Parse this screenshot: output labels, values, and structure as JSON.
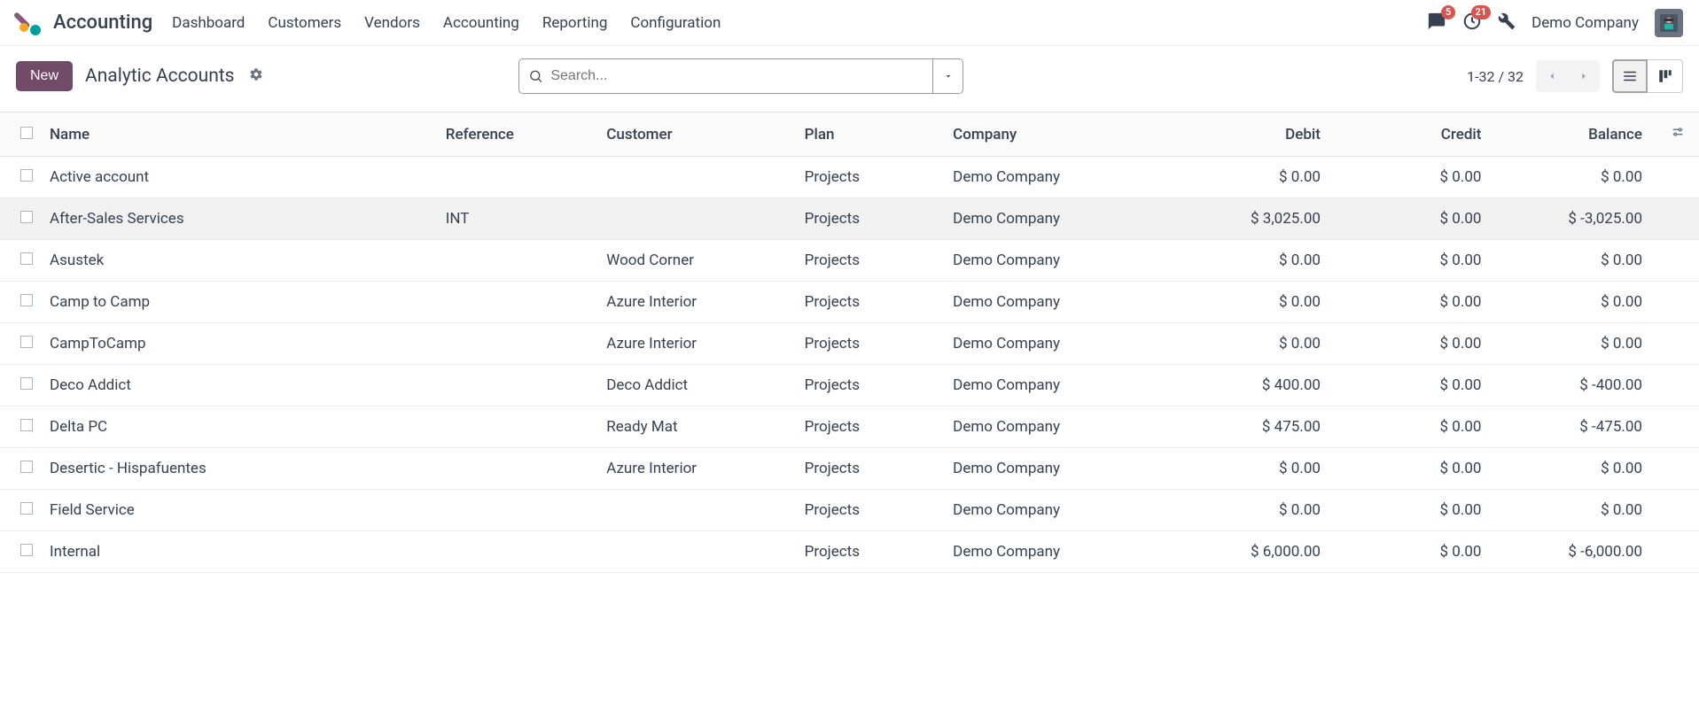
{
  "nav": {
    "app_title": "Accounting",
    "items": [
      "Dashboard",
      "Customers",
      "Vendors",
      "Accounting",
      "Reporting",
      "Configuration"
    ],
    "messages_badge": "5",
    "activities_badge": "21",
    "company": "Demo Company"
  },
  "control": {
    "new_label": "New",
    "breadcrumb": "Analytic Accounts",
    "search_placeholder": "Search...",
    "pager": "1-32 / 32"
  },
  "table": {
    "headers": {
      "name": "Name",
      "reference": "Reference",
      "customer": "Customer",
      "plan": "Plan",
      "company": "Company",
      "debit": "Debit",
      "credit": "Credit",
      "balance": "Balance"
    },
    "rows": [
      {
        "name": "Active account",
        "reference": "",
        "customer": "",
        "plan": "Projects",
        "company": "Demo Company",
        "debit": "$ 0.00",
        "credit": "$ 0.00",
        "balance": "$ 0.00",
        "hover": false
      },
      {
        "name": "After-Sales Services",
        "reference": "INT",
        "customer": "",
        "plan": "Projects",
        "company": "Demo Company",
        "debit": "$ 3,025.00",
        "credit": "$ 0.00",
        "balance": "$ -3,025.00",
        "hover": true
      },
      {
        "name": "Asustek",
        "reference": "",
        "customer": "Wood Corner",
        "plan": "Projects",
        "company": "Demo Company",
        "debit": "$ 0.00",
        "credit": "$ 0.00",
        "balance": "$ 0.00",
        "hover": false
      },
      {
        "name": "Camp to Camp",
        "reference": "",
        "customer": "Azure Interior",
        "plan": "Projects",
        "company": "Demo Company",
        "debit": "$ 0.00",
        "credit": "$ 0.00",
        "balance": "$ 0.00",
        "hover": false
      },
      {
        "name": "CampToCamp",
        "reference": "",
        "customer": "Azure Interior",
        "plan": "Projects",
        "company": "Demo Company",
        "debit": "$ 0.00",
        "credit": "$ 0.00",
        "balance": "$ 0.00",
        "hover": false
      },
      {
        "name": "Deco Addict",
        "reference": "",
        "customer": "Deco Addict",
        "plan": "Projects",
        "company": "Demo Company",
        "debit": "$ 400.00",
        "credit": "$ 0.00",
        "balance": "$ -400.00",
        "hover": false
      },
      {
        "name": "Delta PC",
        "reference": "",
        "customer": "Ready Mat",
        "plan": "Projects",
        "company": "Demo Company",
        "debit": "$ 475.00",
        "credit": "$ 0.00",
        "balance": "$ -475.00",
        "hover": false
      },
      {
        "name": "Desertic - Hispafuentes",
        "reference": "",
        "customer": "Azure Interior",
        "plan": "Projects",
        "company": "Demo Company",
        "debit": "$ 0.00",
        "credit": "$ 0.00",
        "balance": "$ 0.00",
        "hover": false
      },
      {
        "name": "Field Service",
        "reference": "",
        "customer": "",
        "plan": "Projects",
        "company": "Demo Company",
        "debit": "$ 0.00",
        "credit": "$ 0.00",
        "balance": "$ 0.00",
        "hover": false
      },
      {
        "name": "Internal",
        "reference": "",
        "customer": "",
        "plan": "Projects",
        "company": "Demo Company",
        "debit": "$ 6,000.00",
        "credit": "$ 0.00",
        "balance": "$ -6,000.00",
        "hover": false
      }
    ]
  }
}
